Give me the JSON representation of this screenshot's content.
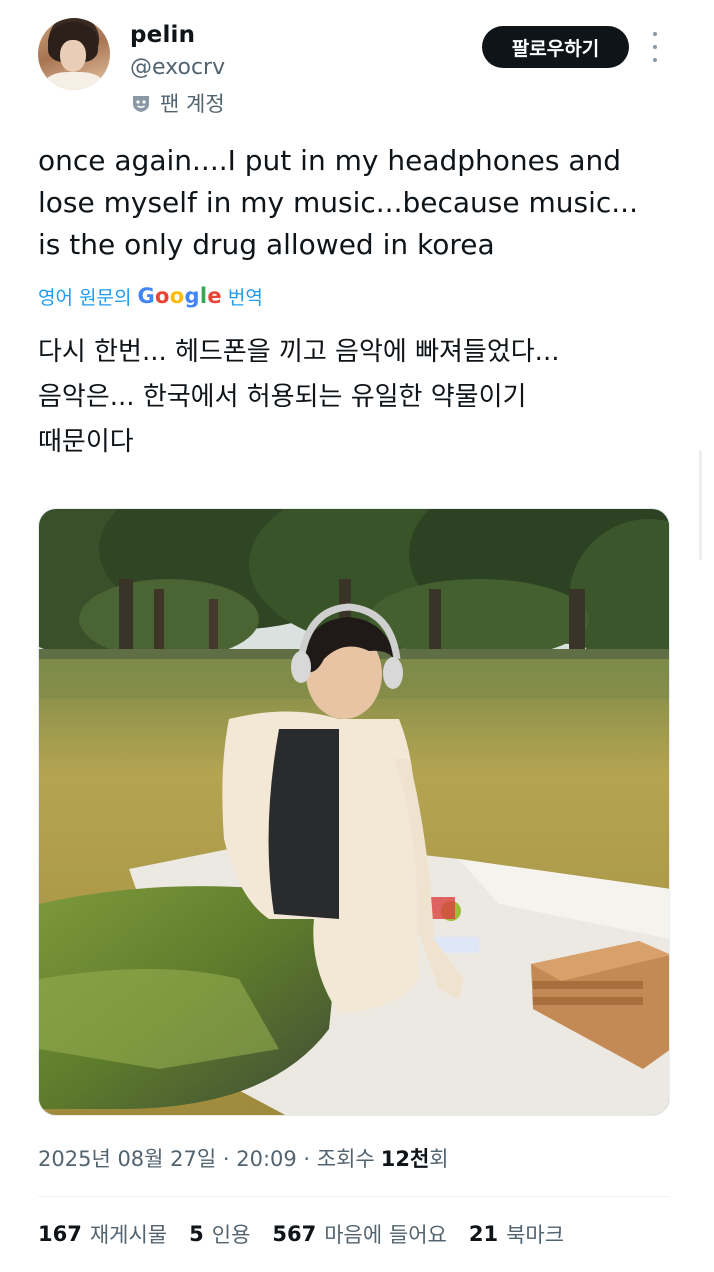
{
  "user": {
    "display_name": "pelin",
    "handle": "@exocrv",
    "fan_label": "팬 계정",
    "follow_label": "팔로우하기"
  },
  "tweet": {
    "text_line1": "once again....I put in my headphones and",
    "text_line2": "lose myself in my music...because music...",
    "text_line3": "is the only drug allowed in korea",
    "translate_prefix": "영어 원문의",
    "translate_google": "Google",
    "translate_suffix": "번역",
    "translated_line1": "다시 한번... 헤드폰을 끼고 음악에 빠져들었다...",
    "translated_line2": "음악은... 한국에서 허용되는 유일한 약물이기",
    "translated_line3": "때문이다"
  },
  "meta": {
    "timestamp": "2025년 08월 27일 · 20:09 · 조회수",
    "views_num": "12천",
    "views_suffix": "회"
  },
  "stats": {
    "retweets_num": "167",
    "retweets_label": "재게시물",
    "quotes_num": "5",
    "quotes_label": "인용",
    "likes_num": "567",
    "likes_label": "마음에 들어요",
    "bookmarks_num": "21",
    "bookmarks_label": "북마크"
  },
  "icons": {
    "more": "more-vertical-icon",
    "fan": "fan-account-icon"
  },
  "colors": {
    "link": "#1d9bf0",
    "secondary_text": "#536471",
    "button_bg": "#0f1419"
  }
}
